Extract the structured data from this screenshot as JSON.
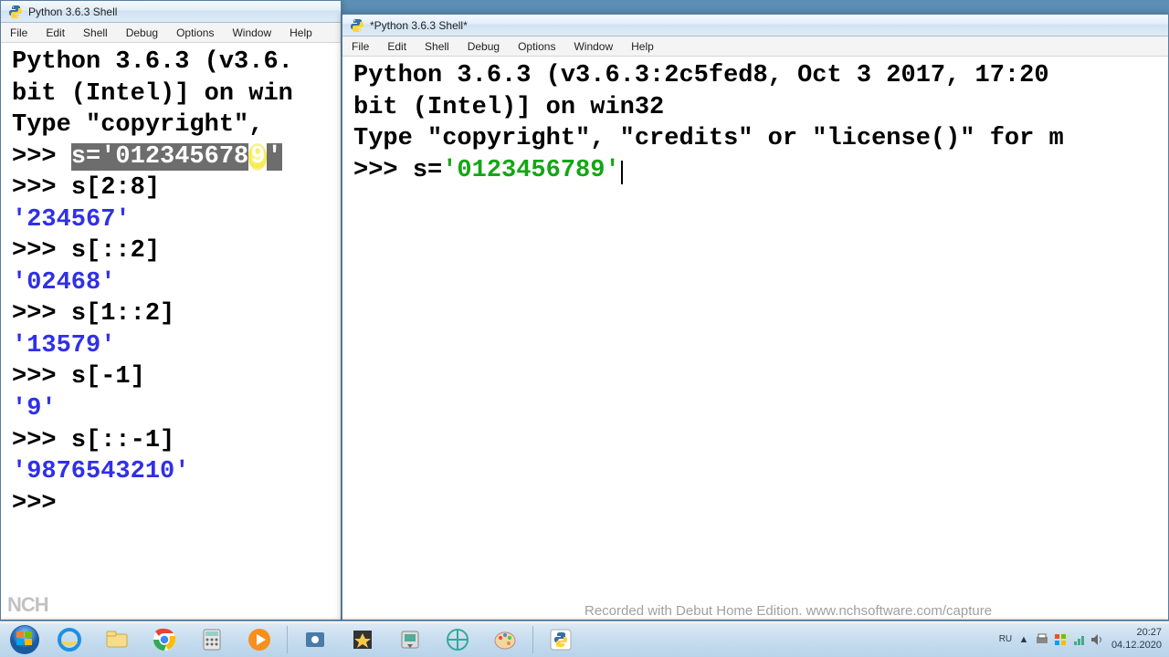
{
  "left_window": {
    "title": "Python 3.6.3 Shell",
    "menu": [
      "File",
      "Edit",
      "Shell",
      "Debug",
      "Options",
      "Window",
      "Help"
    ],
    "lines": {
      "l1": "Python 3.6.3 (v3.6.",
      "l2": "bit (Intel)] on win",
      "l3a": "Type ",
      "l3b": "\"copyright\"",
      "l3c": ", ",
      "p1": ">>> ",
      "s1a": "s='012345678",
      "s1b": "9",
      "s1c": "'",
      "p2": ">>> ",
      "c2": "s[2:8]",
      "o1": "'234567'",
      "p3": ">>> ",
      "c3": "s[::2]",
      "o2": "'02468'",
      "p4": ">>> ",
      "c4": "s[1::2]",
      "o3": "'13579'",
      "p5": ">>> ",
      "c5": "s[-1]",
      "o4": "'9'",
      "p6": ">>> ",
      "c6": "s[::-1]",
      "o5": "'9876543210'",
      "p7": ">>> "
    }
  },
  "right_window": {
    "title": "*Python 3.6.3 Shell*",
    "menu": [
      "File",
      "Edit",
      "Shell",
      "Debug",
      "Options",
      "Window",
      "Help"
    ],
    "lines": {
      "l1": "Python 3.6.3 (v3.6.3:2c5fed8, Oct  3 2017, 17:20",
      "l2": "bit (Intel)] on win32",
      "l3": "Type \"copyright\", \"credits\" or \"license()\" for m",
      "p1": ">>> ",
      "c1a": "s=",
      "c1b": "'0123456789'"
    }
  },
  "watermark": "Recorded with Debut Home Edition. www.nchsoftware.com/capture",
  "nch": "NCH",
  "tray": {
    "lang": "RU",
    "time": "20:27",
    "date": "04.12.2020"
  }
}
